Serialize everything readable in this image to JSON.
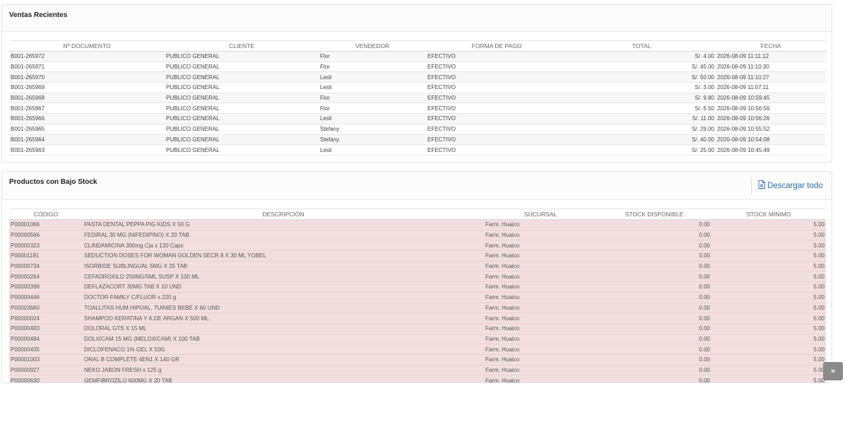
{
  "ventas": {
    "title": "Ventas Recientes",
    "headers": [
      "Nº DOCUMENTO",
      "CLIENTE",
      "VENDEDOR",
      "FORMA DE PAGO",
      "TOTAL",
      "FECHA"
    ],
    "rows": [
      {
        "doc": "B001-265972",
        "cliente": "PUBLICO GENERAL",
        "vendedor": "Flor",
        "pago": "EFECTIVO",
        "total": "S/. 4.00",
        "fecha": "2026-08-09 11:11:12"
      },
      {
        "doc": "B001-265971",
        "cliente": "PUBLICO GENERAL",
        "vendedor": "Flor",
        "pago": "EFECTIVO",
        "total": "S/. 45.00",
        "fecha": "2026-08-09 11:10:30"
      },
      {
        "doc": "B001-265970",
        "cliente": "PUBLICO GENERAL",
        "vendedor": "Lesli",
        "pago": "EFECTIVO",
        "total": "S/. 50.00",
        "fecha": "2026-08-09 11:10:27"
      },
      {
        "doc": "B001-265969",
        "cliente": "PUBLICO GENERAL",
        "vendedor": "Lesli",
        "pago": "EFECTIVO",
        "total": "S/. 3.00",
        "fecha": "2026-08-09 11:07:11"
      },
      {
        "doc": "B001-265968",
        "cliente": "PUBLICO GENERAL",
        "vendedor": "Flor",
        "pago": "EFECTIVO",
        "total": "S/. 9.80",
        "fecha": "2026-08-09 10:59:45"
      },
      {
        "doc": "B001-265967",
        "cliente": "PUBLICO GENERAL",
        "vendedor": "Flor",
        "pago": "EFECTIVO",
        "total": "S/. 6.50",
        "fecha": "2026-08-09 10:56:56"
      },
      {
        "doc": "B001-265966",
        "cliente": "PUBLICO GENERAL",
        "vendedor": "Lesli",
        "pago": "EFECTIVO",
        "total": "S/. 11.00",
        "fecha": "2026-08-09 10:56:26"
      },
      {
        "doc": "B001-265965",
        "cliente": "PUBLICO GENERAL",
        "vendedor": "Stefany",
        "pago": "EFECTIVO",
        "total": "S/. 29.00",
        "fecha": "2026-08-09 10:55:52"
      },
      {
        "doc": "B001-265964",
        "cliente": "PUBLICO GENERAL",
        "vendedor": "Stefany",
        "pago": "EFECTIVO",
        "total": "S/. 40.00",
        "fecha": "2026-08-09 10:54:08"
      },
      {
        "doc": "B001-265963",
        "cliente": "PUBLICO GENERAL",
        "vendedor": "Lesli",
        "pago": "EFECTIVO",
        "total": "S/. 25.00",
        "fecha": "2026-08-09 10:45:49"
      }
    ]
  },
  "stock": {
    "title": "Productos con Bajo Stock",
    "download_label": "Descargar todo",
    "download_icon": "file-excel-icon",
    "headers": [
      "CÓDIGO",
      "DESCRIPCIÓN",
      "SUCURSAL",
      "STOCK DISPONIBLE",
      "STOCK MÍNIMO"
    ],
    "rows": [
      {
        "codigo": "P00001066",
        "desc": "PASTA DENTAL PEPPA PIG KIDS X 50 G",
        "sucursal": "Farm. Huaico",
        "disp": "0.00",
        "min": "5.00"
      },
      {
        "codigo": "P00000566",
        "desc": "FEDIRAL 30 MG (NIFEDIPINO) X 20 TAB",
        "sucursal": "Farm. Huaico",
        "disp": "0.00",
        "min": "5.00"
      },
      {
        "codigo": "P00000323",
        "desc": "CLINDAMICINA 300mg Cja x 120 Caps",
        "sucursal": "Farm. Huaico",
        "disp": "0.00",
        "min": "5.00"
      },
      {
        "codigo": "P00001181",
        "desc": "SEDUCTION DOSES FOR WOMAN GOLDEN SECR 8 X 30 ML YOBEL",
        "sucursal": "Farm. Huaico",
        "disp": "0.00",
        "min": "5.00"
      },
      {
        "codigo": "P00000734",
        "desc": "ISORBIDE SUBLINGUAL 5MG X 25 TAB",
        "sucursal": "Farm. Huaico",
        "disp": "0.00",
        "min": "5.00"
      },
      {
        "codigo": "P00000264",
        "desc": "CEFADROXILO 250MG/5ML SUSP X 100 ML",
        "sucursal": "Farm. Huaico",
        "disp": "0.00",
        "min": "5.00"
      },
      {
        "codigo": "P00000398",
        "desc": "DEFLAZACORT 30MG TAB X 10 UND",
        "sucursal": "Farm. Huaico",
        "disp": "0.00",
        "min": "5.00"
      },
      {
        "codigo": "P00000446",
        "desc": "DOCTOR FAMILY C/FLUOR x 220 g",
        "sucursal": "Farm. Huaico",
        "disp": "0.00",
        "min": "5.00"
      },
      {
        "codigo": "P00003680",
        "desc": "TOALLITAS HUM.HIPOAL. TUINIES BEBE X 60 UND",
        "sucursal": "Farm. Huaico",
        "disp": "0.00",
        "min": "5.00"
      },
      {
        "codigo": "P00000024",
        "desc": "SHAMPOO KERATINA Y A.DE ARGAN X 500 ML",
        "sucursal": "Farm. Huaico",
        "disp": "0.00",
        "min": "5.00"
      },
      {
        "codigo": "P00000483",
        "desc": "DOLORAL GTS X 15 ML",
        "sucursal": "Farm. Huaico",
        "disp": "0.00",
        "min": "5.00"
      },
      {
        "codigo": "P00000484",
        "desc": "DOLXICAM 15 MG (MELOXICAM) X 100 TAB",
        "sucursal": "Farm. Huaico",
        "disp": "0.00",
        "min": "5.00"
      },
      {
        "codigo": "P00000435",
        "desc": "DICLOFENACO 1% GEL X 50G",
        "sucursal": "Farm. Huaico",
        "disp": "0.00",
        "min": "5.00"
      },
      {
        "codigo": "P00001003",
        "desc": "ORAL B COMPLETE 4EN1 X 140 GR",
        "sucursal": "Farm. Huaico",
        "disp": "0.00",
        "min": "5.00"
      },
      {
        "codigo": "P00000927",
        "desc": "NEKO JABON FRESH x 125 g",
        "sucursal": "Farm. Huaico",
        "disp": "0.00",
        "min": "5.00"
      },
      {
        "codigo": "P00000630",
        "desc": "GEMFIBROZILO 600MG X 20 TAB",
        "sucursal": "Farm. Huaico",
        "disp": "0.00",
        "min": "5.00"
      }
    ]
  },
  "scroll_top_icon": "double-chevron-up-icon",
  "colors": {
    "low_stock_row": "#f2dede",
    "link": "#2a6fb5",
    "scroll_button": "#8a8a8a"
  }
}
